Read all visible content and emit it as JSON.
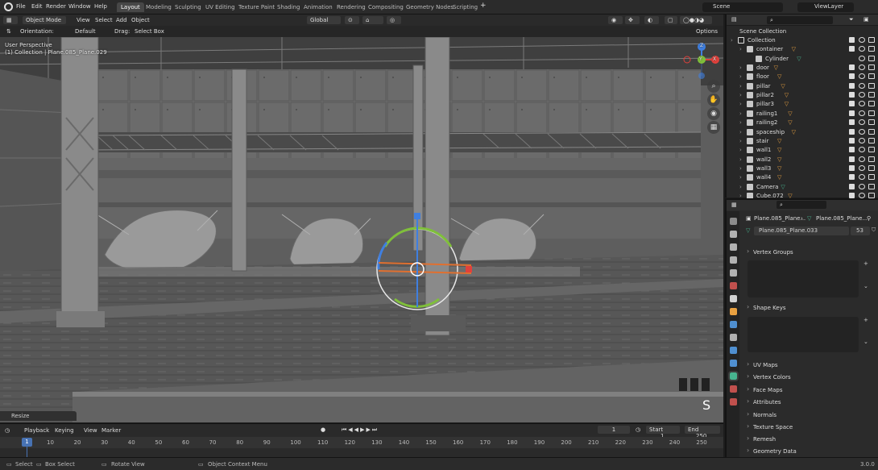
{
  "menus": [
    "File",
    "Edit",
    "Render",
    "Window",
    "Help"
  ],
  "workspaces": [
    "Layout",
    "Modeling",
    "Sculpting",
    "UV Editing",
    "Texture Paint",
    "Shading",
    "Animation",
    "Rendering",
    "Compositing",
    "Geometry Nodes",
    "Scripting"
  ],
  "active_workspace": "Layout",
  "scene_name": "Scene",
  "view_layer": "ViewLayer",
  "viewport_header": {
    "mode": "Object Mode",
    "menus": [
      "View",
      "Select",
      "Add",
      "Object"
    ],
    "transform_orientation": "Global",
    "options_label": "Options"
  },
  "tool_header": {
    "orientation_label": "Orientation:",
    "orientation_value": "Default",
    "drag_label": "Drag:",
    "drag_value": "Select Box"
  },
  "viewport_overlay": {
    "perspective": "User Perspective",
    "collection_info": "(1) Collection | Plane.085_Plane.029",
    "key_hint": "S"
  },
  "nav_gizmo": {
    "x": "X",
    "y": "Y",
    "z": "Z"
  },
  "last_operator": "Resize",
  "timeline": {
    "menus": [
      "Playback",
      "Keying",
      "View",
      "Marker"
    ],
    "current_frame": "1",
    "start_label": "Start",
    "start": "1",
    "end_label": "End",
    "end": "250",
    "frame_ticks": [
      "1",
      "10",
      "20",
      "30",
      "40",
      "50",
      "60",
      "70",
      "80",
      "90",
      "100",
      "110",
      "120",
      "130",
      "140",
      "150",
      "160",
      "170",
      "180",
      "190",
      "200",
      "210",
      "220",
      "230",
      "240",
      "250"
    ]
  },
  "outliner": {
    "scene_collection": "Scene Collection",
    "items": [
      {
        "label": "Collection",
        "indent": 0,
        "kind": "collection"
      },
      {
        "label": "container",
        "indent": 1,
        "kind": "object"
      },
      {
        "label": "Cylinder",
        "indent": 2,
        "kind": "mesh"
      },
      {
        "label": "door",
        "indent": 1,
        "kind": "object"
      },
      {
        "label": "floor",
        "indent": 1,
        "kind": "object"
      },
      {
        "label": "pillar",
        "indent": 1,
        "kind": "object"
      },
      {
        "label": "pillar2",
        "indent": 1,
        "kind": "object"
      },
      {
        "label": "pillar3",
        "indent": 1,
        "kind": "object"
      },
      {
        "label": "railing1",
        "indent": 1,
        "kind": "object"
      },
      {
        "label": "railing2",
        "indent": 1,
        "kind": "object"
      },
      {
        "label": "spaceship",
        "indent": 1,
        "kind": "object"
      },
      {
        "label": "stair",
        "indent": 1,
        "kind": "object"
      },
      {
        "label": "wall1",
        "indent": 1,
        "kind": "object"
      },
      {
        "label": "wall2",
        "indent": 1,
        "kind": "object"
      },
      {
        "label": "wall3",
        "indent": 1,
        "kind": "object"
      },
      {
        "label": "wall4",
        "indent": 1,
        "kind": "object"
      },
      {
        "label": "Camera",
        "indent": 1,
        "kind": "camera"
      },
      {
        "label": "Cube.072",
        "indent": 1,
        "kind": "object"
      }
    ]
  },
  "properties": {
    "breadcrumb": [
      "Plane.085_Plane...",
      "Plane.085_Plane..."
    ],
    "mesh_name": "Plane.085_Plane.033",
    "users": "53",
    "sections": [
      "Vertex Groups",
      "Shape Keys",
      "UV Maps",
      "Vertex Colors",
      "Face Maps",
      "Attributes",
      "Normals",
      "Texture Space",
      "Remesh",
      "Geometry Data"
    ]
  },
  "statusbar": {
    "items": [
      "Select",
      "Box Select",
      "Rotate View",
      "Object Context Menu"
    ],
    "version": "3.0.0"
  },
  "colors": {
    "accent": "#4772b3",
    "header": "#2b2b2b",
    "panel": "#282828",
    "viewport": "#5e5e5e",
    "object_icon": "#e8a040",
    "mesh_icon": "#47b38f",
    "gizmo_x": "#e0413c",
    "gizmo_y": "#7fbf3a",
    "gizmo_z": "#3f7fe0"
  }
}
